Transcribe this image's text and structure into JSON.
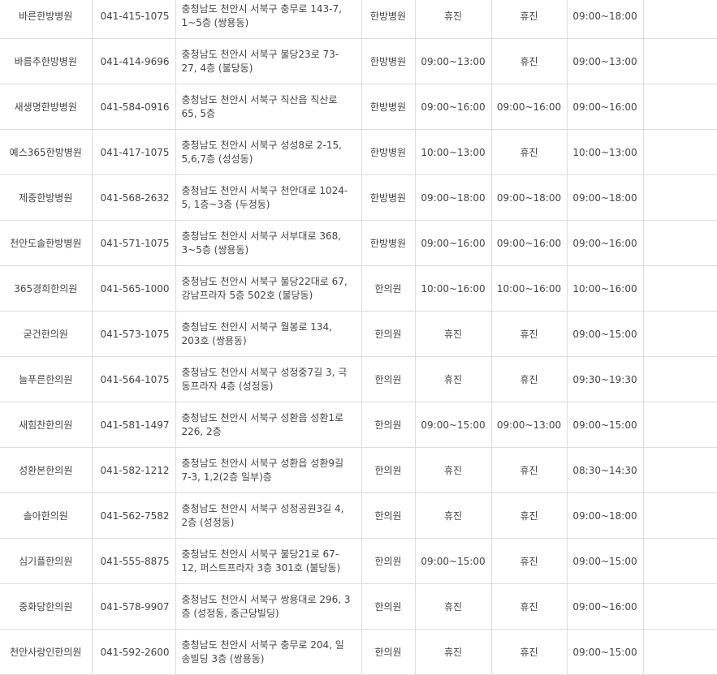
{
  "rows": [
    {
      "name": "바른한방병원",
      "phone": "041-415-1075",
      "address": "충청남도 천안시 서북구 충무로 143-7, 1~5층 (쌍용동)",
      "type": "한방병원",
      "h1": "휴진",
      "h2": "휴진",
      "h3": "09:00~18:00"
    },
    {
      "name": "바름추한방병원",
      "phone": "041-414-9696",
      "address": "충청남도 천안시 서북구 불당23로 73-27, 4층 (불당동)",
      "type": "한방병원",
      "h1": "09:00~13:00",
      "h2": "휴진",
      "h3": "09:00~13:00"
    },
    {
      "name": "새생명한방병원",
      "phone": "041-584-0916",
      "address": "충청남도 천안시 서북구 직산읍 직산로 65, 5층",
      "type": "한방병원",
      "h1": "09:00~16:00",
      "h2": "09:00~16:00",
      "h3": "09:00~16:00"
    },
    {
      "name": "예스365한방병원",
      "phone": "041-417-1075",
      "address": "충청남도 천안시 서북구 성성8로 2-15, 5,6,7층 (성성동)",
      "type": "한방병원",
      "h1": "10:00~13:00",
      "h2": "휴진",
      "h3": "10:00~13:00"
    },
    {
      "name": "제중한방병원",
      "phone": "041-568-2632",
      "address": "충청남도 천안시 서북구 천안대로 1024-5, 1층~3층 (두정동)",
      "type": "한방병원",
      "h1": "09:00~18:00",
      "h2": "09:00~18:00",
      "h3": "09:00~18:00"
    },
    {
      "name": "천안도솔한방병원",
      "phone": "041-571-1075",
      "address": "충청남도 천안시 서북구 서부대로 368, 3~5층 (쌍용동)",
      "type": "한방병원",
      "h1": "09:00~16:00",
      "h2": "09:00~16:00",
      "h3": "09:00~16:00"
    },
    {
      "name": "365경희한의원",
      "phone": "041-565-1000",
      "address": "충청남도 천안시 서북구 불당22대로 67, 강남프라자 5층 502호 (불당동)",
      "type": "한의원",
      "h1": "10:00~16:00",
      "h2": "10:00~16:00",
      "h3": "10:00~16:00"
    },
    {
      "name": "굳건한의원",
      "phone": "041-573-1075",
      "address": "충청남도 천안시 서북구 월봉로 134, 203호 (쌍용동)",
      "type": "한의원",
      "h1": "휴진",
      "h2": "휴진",
      "h3": "09:00~15:00"
    },
    {
      "name": "늘푸른한의원",
      "phone": "041-564-1075",
      "address": "충청남도 천안시 서북구 성정중7길 3, 극동프라자 4층 (성정동)",
      "type": "한의원",
      "h1": "휴진",
      "h2": "휴진",
      "h3": "09:30~19:30"
    },
    {
      "name": "새힘찬한의원",
      "phone": "041-581-1497",
      "address": "충청남도 천안시 서북구 성환읍 성환1로 226, 2층",
      "type": "한의원",
      "h1": "09:00~15:00",
      "h2": "09:00~13:00",
      "h3": "09:00~15:00"
    },
    {
      "name": "성환본한의원",
      "phone": "041-582-1212",
      "address": "충청남도 천안시 서북구 성환읍 성환9길 7-3, 1,2(2층 일부)층",
      "type": "한의원",
      "h1": "휴진",
      "h2": "휴진",
      "h3": "08:30~14:30"
    },
    {
      "name": "솔아한의원",
      "phone": "041-562-7582",
      "address": "충청남도 천안시 서북구 성정공원3길 4, 2층 (성정동)",
      "type": "한의원",
      "h1": "휴진",
      "h2": "휴진",
      "h3": "09:00~18:00"
    },
    {
      "name": "심기플한의원",
      "phone": "041-555-8875",
      "address": "충청남도 천안시 서북구 불당21로 67-12, 퍼스트프라자 3층 301호 (불당동)",
      "type": "한의원",
      "h1": "09:00~15:00",
      "h2": "휴진",
      "h3": "09:00~15:00"
    },
    {
      "name": "중화당한의원",
      "phone": "041-578-9907",
      "address": "충청남도 천안시 서북구 쌍용대로 296, 3층 (성정동, 종근당빌딩)",
      "type": "한의원",
      "h1": "휴진",
      "h2": "휴진",
      "h3": "09:00~16:00"
    },
    {
      "name": "천안사랑인한의원",
      "phone": "041-592-2600",
      "address": "충청남도 천안시 서북구 충무로 204, 일송빌딩 3층 (쌍용동)",
      "type": "한의원",
      "h1": "휴진",
      "h2": "휴진",
      "h3": "09:00~15:00"
    }
  ]
}
